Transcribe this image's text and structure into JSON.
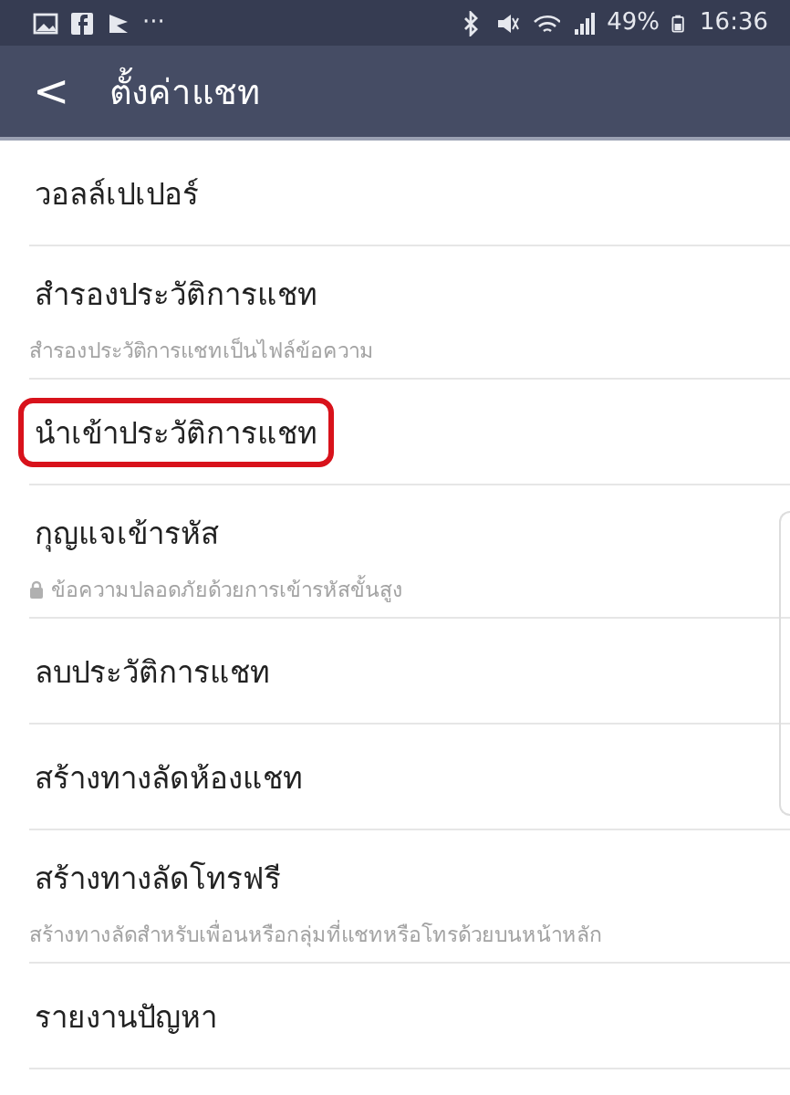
{
  "status_bar": {
    "more": "···",
    "battery": "49%",
    "time": "16:36"
  },
  "header": {
    "back": "<",
    "title": "ตั้งค่าแชท"
  },
  "items": [
    {
      "title": "วอลล์เปเปอร์",
      "highlighted": false
    },
    {
      "title": "สำรองประวัติการแชท",
      "subtitle": "สำรองประวัติการแชทเป็นไฟล์ข้อความ",
      "highlighted": false
    },
    {
      "title": "นำเข้าประวัติการแชท",
      "highlighted": true
    },
    {
      "title": "กุญแจเข้ารหัส",
      "subtitle": "ข้อความปลอดภัยด้วยการเข้ารหัสขั้นสูง",
      "locked": true,
      "highlighted": false
    },
    {
      "title": "ลบประวัติการแชท",
      "highlighted": false
    },
    {
      "title": "สร้างทางลัดห้องแชท",
      "highlighted": false
    },
    {
      "title": "สร้างทางลัดโทรฟรี",
      "subtitle": "สร้างทางลัดสำหรับเพื่อนหรือกลุ่มที่แชทหรือโทรด้วยบนหน้าหลัก",
      "highlighted": false
    },
    {
      "title": "รายงานปัญหา",
      "highlighted": false
    }
  ]
}
